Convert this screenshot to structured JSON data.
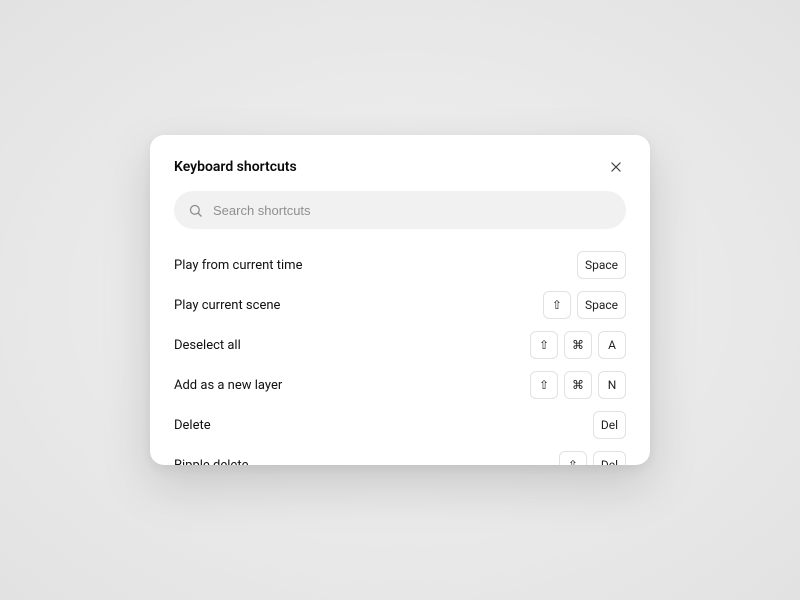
{
  "dialog": {
    "title": "Keyboard shortcuts",
    "search_placeholder": "Search shortcuts"
  },
  "key_symbols": {
    "shift": "⇧",
    "cmd": "⌘"
  },
  "shortcuts": [
    {
      "label": "Play from current time",
      "keys": [
        "Space"
      ]
    },
    {
      "label": "Play current scene",
      "keys": [
        "⇧",
        "Space"
      ]
    },
    {
      "label": "Deselect all",
      "keys": [
        "⇧",
        "⌘",
        "A"
      ]
    },
    {
      "label": "Add as a new layer",
      "keys": [
        "⇧",
        "⌘",
        "N"
      ]
    },
    {
      "label": "Delete",
      "keys": [
        "Del"
      ]
    },
    {
      "label": "Ripple delete",
      "keys": [
        "⇧",
        "Del"
      ]
    }
  ]
}
